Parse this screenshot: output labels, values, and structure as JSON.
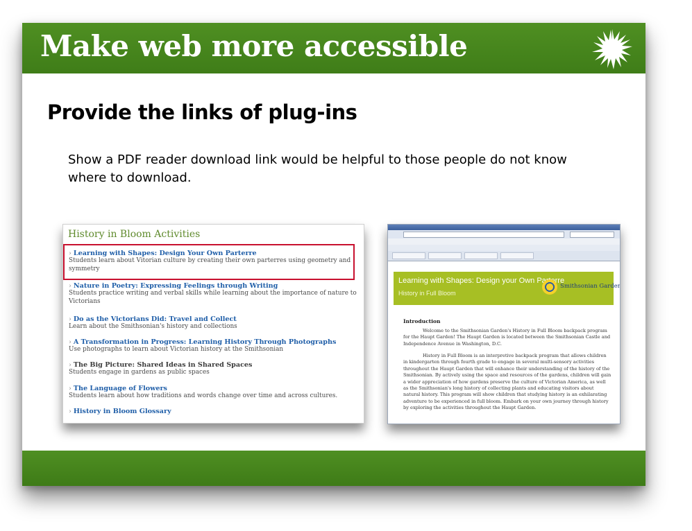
{
  "slide": {
    "title": "Make web more accessible",
    "heading": "Provide the links of plug-ins",
    "body": "Show a PDF reader download link would be helpful to those people do not know where to download."
  },
  "left_screenshot": {
    "heading": "History in Bloom Activities",
    "items": [
      {
        "title": "Learning with Shapes: Design Your Own Parterre",
        "desc": "Students learn about Vitorian culture by creating their own parterres using geometry and symmetry"
      },
      {
        "title": "Nature in Poetry: Expressing Feelings through Writing",
        "desc": "Students practice writing and verbal skills while learning about the importance of nature to Victorians"
      },
      {
        "title": "Do as the Victorians Did: Travel and Collect",
        "desc": "Learn about the Smithsonian's history and collections"
      },
      {
        "title": "A Transformation in Progress: Learning History Through Photographs",
        "desc": "Use photographs to learn about Victorian history at the Smithsonian"
      },
      {
        "title": "The Big Picture: Shared Ideas in Shared Spaces",
        "desc": "Students engage in gardens as public spaces"
      },
      {
        "title": "The Language of Flowers",
        "desc": "Students learn about how traditions and words change over time and across cultures."
      },
      {
        "title": "History in Bloom Glossary",
        "desc": ""
      }
    ]
  },
  "right_screenshot": {
    "banner_title": "Learning with Shapes: Design your Own Parterre",
    "banner_subtitle": "History in Full Bloom",
    "logo_text": "Smithsonian Gardens",
    "intro_heading": "Introduction",
    "intro_p1": "Welcome to the Smithsonian Garden's History in Full Bloom backpack program for the Haupt Garden! The Haupt Garden is located between the Smithsonian Castle and Independence Avenue in Washington, D.C.",
    "intro_p2": "History in Full Bloom is an interpretive backpack program that allows children in kindergarten through fourth grade to engage in several multi-sensory activities throughout the Haupt Garden that will enhance their understanding of the history of the Smithsonian. By actively using the space and resources of the gardens, children will gain a wider appreciation of how gardens preserve the culture of Victorian America, as well as the Smithsonian's long history of collecting plants and educating visitors about natural history. This program will show children that studying history is an exhilarating adventure to be experienced in full bloom. Embark on your own journey through history by exploring the activities throughout the Haupt Garden."
  },
  "colors": {
    "band_green": "#4a8a1f",
    "link_blue": "#1f5ea8",
    "highlight_red": "#c8102e",
    "banner_green": "#a7bf24"
  },
  "icons": [
    "sunburst-logo-icon"
  ]
}
